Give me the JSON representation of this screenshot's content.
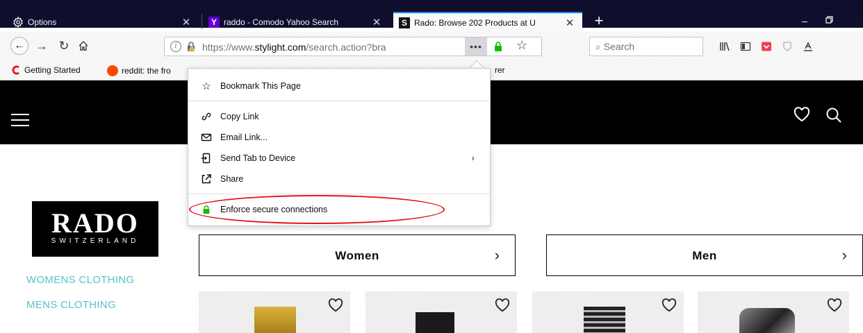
{
  "tabs": [
    {
      "title": "Options",
      "icon": "gear-icon",
      "selected": false
    },
    {
      "title": "raddo - Comodo Yahoo Search",
      "icon": "yahoo-icon",
      "selected": false
    },
    {
      "title": "Rado: Browse 202 Products at U",
      "icon": "stylight-icon",
      "selected": true
    }
  ],
  "toolbar": {
    "url_prefix": "https://www.",
    "url_domain": "stylight.com",
    "url_rest": "/search.action?bra",
    "page_actions_label": "•••",
    "search_placeholder": "Search"
  },
  "bookmarks": [
    {
      "label": "Getting Started",
      "icon": "getting-started-icon"
    },
    {
      "label": "reddit: the fro",
      "icon": "reddit-icon"
    },
    {
      "label": "rer",
      "icon": "bookmark-icon"
    }
  ],
  "menu": {
    "items": [
      {
        "label": "Bookmark This Page",
        "icon": "star-icon"
      },
      {
        "label": "Copy Link",
        "icon": "link-icon"
      },
      {
        "label": "Email Link...",
        "icon": "email-icon"
      },
      {
        "label": "Send Tab to Device",
        "icon": "send-tab-icon",
        "submenu": "›"
      },
      {
        "label": "Share",
        "icon": "share-icon"
      },
      {
        "label": "Enforce secure connections",
        "icon": "lock-icon"
      }
    ]
  },
  "page": {
    "brand_name": "RADO",
    "brand_sub": "SWITZERLAND",
    "categories": [
      "WOMENS CLOTHING",
      "MENS CLOTHING"
    ],
    "gender_buttons": [
      {
        "label": "Women",
        "chevron": "›"
      },
      {
        "label": "Men",
        "chevron": "›"
      }
    ]
  },
  "colors": {
    "accent": "#0a84ff",
    "link_teal": "#56c1c9",
    "highlight_red": "#e3151a",
    "header_black": "#000000",
    "tabbar_dark": "#0c0c2a"
  }
}
